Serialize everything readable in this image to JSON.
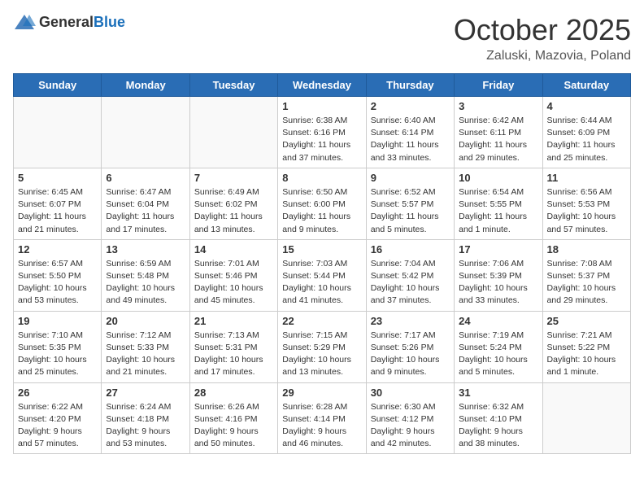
{
  "header": {
    "logo_general": "General",
    "logo_blue": "Blue",
    "month_title": "October 2025",
    "location": "Zaluski, Mazovia, Poland"
  },
  "weekdays": [
    "Sunday",
    "Monday",
    "Tuesday",
    "Wednesday",
    "Thursday",
    "Friday",
    "Saturday"
  ],
  "weeks": [
    [
      {
        "day": "",
        "info": ""
      },
      {
        "day": "",
        "info": ""
      },
      {
        "day": "",
        "info": ""
      },
      {
        "day": "1",
        "info": "Sunrise: 6:38 AM\nSunset: 6:16 PM\nDaylight: 11 hours\nand 37 minutes."
      },
      {
        "day": "2",
        "info": "Sunrise: 6:40 AM\nSunset: 6:14 PM\nDaylight: 11 hours\nand 33 minutes."
      },
      {
        "day": "3",
        "info": "Sunrise: 6:42 AM\nSunset: 6:11 PM\nDaylight: 11 hours\nand 29 minutes."
      },
      {
        "day": "4",
        "info": "Sunrise: 6:44 AM\nSunset: 6:09 PM\nDaylight: 11 hours\nand 25 minutes."
      }
    ],
    [
      {
        "day": "5",
        "info": "Sunrise: 6:45 AM\nSunset: 6:07 PM\nDaylight: 11 hours\nand 21 minutes."
      },
      {
        "day": "6",
        "info": "Sunrise: 6:47 AM\nSunset: 6:04 PM\nDaylight: 11 hours\nand 17 minutes."
      },
      {
        "day": "7",
        "info": "Sunrise: 6:49 AM\nSunset: 6:02 PM\nDaylight: 11 hours\nand 13 minutes."
      },
      {
        "day": "8",
        "info": "Sunrise: 6:50 AM\nSunset: 6:00 PM\nDaylight: 11 hours\nand 9 minutes."
      },
      {
        "day": "9",
        "info": "Sunrise: 6:52 AM\nSunset: 5:57 PM\nDaylight: 11 hours\nand 5 minutes."
      },
      {
        "day": "10",
        "info": "Sunrise: 6:54 AM\nSunset: 5:55 PM\nDaylight: 11 hours\nand 1 minute."
      },
      {
        "day": "11",
        "info": "Sunrise: 6:56 AM\nSunset: 5:53 PM\nDaylight: 10 hours\nand 57 minutes."
      }
    ],
    [
      {
        "day": "12",
        "info": "Sunrise: 6:57 AM\nSunset: 5:50 PM\nDaylight: 10 hours\nand 53 minutes."
      },
      {
        "day": "13",
        "info": "Sunrise: 6:59 AM\nSunset: 5:48 PM\nDaylight: 10 hours\nand 49 minutes."
      },
      {
        "day": "14",
        "info": "Sunrise: 7:01 AM\nSunset: 5:46 PM\nDaylight: 10 hours\nand 45 minutes."
      },
      {
        "day": "15",
        "info": "Sunrise: 7:03 AM\nSunset: 5:44 PM\nDaylight: 10 hours\nand 41 minutes."
      },
      {
        "day": "16",
        "info": "Sunrise: 7:04 AM\nSunset: 5:42 PM\nDaylight: 10 hours\nand 37 minutes."
      },
      {
        "day": "17",
        "info": "Sunrise: 7:06 AM\nSunset: 5:39 PM\nDaylight: 10 hours\nand 33 minutes."
      },
      {
        "day": "18",
        "info": "Sunrise: 7:08 AM\nSunset: 5:37 PM\nDaylight: 10 hours\nand 29 minutes."
      }
    ],
    [
      {
        "day": "19",
        "info": "Sunrise: 7:10 AM\nSunset: 5:35 PM\nDaylight: 10 hours\nand 25 minutes."
      },
      {
        "day": "20",
        "info": "Sunrise: 7:12 AM\nSunset: 5:33 PM\nDaylight: 10 hours\nand 21 minutes."
      },
      {
        "day": "21",
        "info": "Sunrise: 7:13 AM\nSunset: 5:31 PM\nDaylight: 10 hours\nand 17 minutes."
      },
      {
        "day": "22",
        "info": "Sunrise: 7:15 AM\nSunset: 5:29 PM\nDaylight: 10 hours\nand 13 minutes."
      },
      {
        "day": "23",
        "info": "Sunrise: 7:17 AM\nSunset: 5:26 PM\nDaylight: 10 hours\nand 9 minutes."
      },
      {
        "day": "24",
        "info": "Sunrise: 7:19 AM\nSunset: 5:24 PM\nDaylight: 10 hours\nand 5 minutes."
      },
      {
        "day": "25",
        "info": "Sunrise: 7:21 AM\nSunset: 5:22 PM\nDaylight: 10 hours\nand 1 minute."
      }
    ],
    [
      {
        "day": "26",
        "info": "Sunrise: 6:22 AM\nSunset: 4:20 PM\nDaylight: 9 hours\nand 57 minutes."
      },
      {
        "day": "27",
        "info": "Sunrise: 6:24 AM\nSunset: 4:18 PM\nDaylight: 9 hours\nand 53 minutes."
      },
      {
        "day": "28",
        "info": "Sunrise: 6:26 AM\nSunset: 4:16 PM\nDaylight: 9 hours\nand 50 minutes."
      },
      {
        "day": "29",
        "info": "Sunrise: 6:28 AM\nSunset: 4:14 PM\nDaylight: 9 hours\nand 46 minutes."
      },
      {
        "day": "30",
        "info": "Sunrise: 6:30 AM\nSunset: 4:12 PM\nDaylight: 9 hours\nand 42 minutes."
      },
      {
        "day": "31",
        "info": "Sunrise: 6:32 AM\nSunset: 4:10 PM\nDaylight: 9 hours\nand 38 minutes."
      },
      {
        "day": "",
        "info": ""
      }
    ]
  ]
}
